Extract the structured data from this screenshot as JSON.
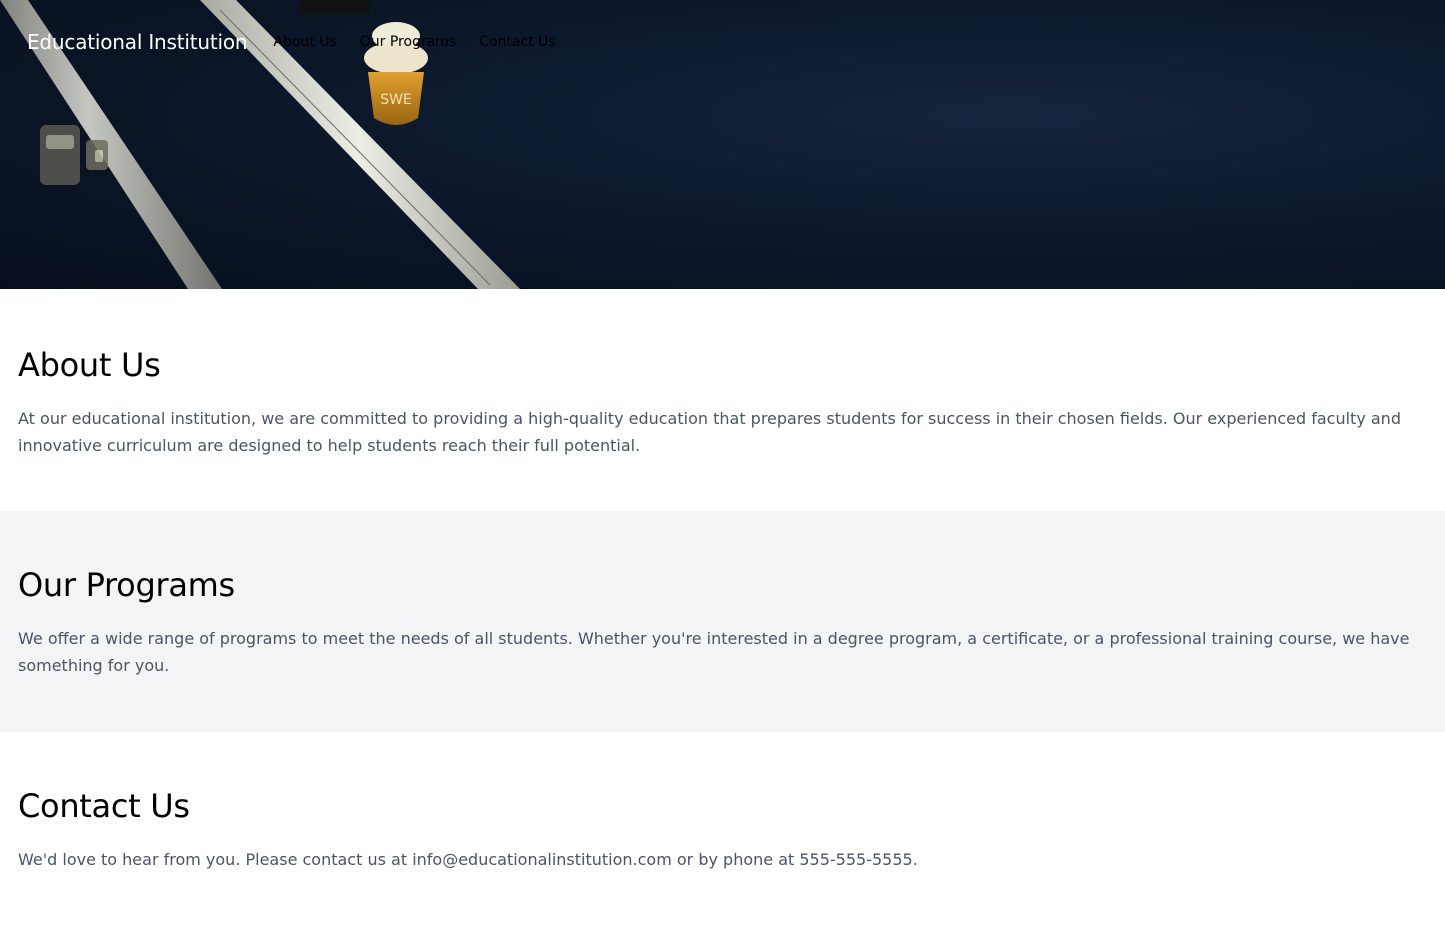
{
  "header": {
    "brand": "Educational Institution",
    "nav": [
      {
        "label": "About Us"
      },
      {
        "label": "Our Programs"
      },
      {
        "label": "Contact Us"
      }
    ]
  },
  "hero": {
    "cone_text": "SWE"
  },
  "about": {
    "title": "About Us",
    "body": "At our educational institution, we are committed to providing a high-quality education that prepares students for success in their chosen fields. Our experienced faculty and innovative curriculum are designed to help students reach their full potential."
  },
  "programs": {
    "title": "Our Programs",
    "body": "We offer a wide range of programs to meet the needs of all students. Whether you're interested in a degree program, a certificate, or a professional training course, we have something for you."
  },
  "contact": {
    "title": "Contact Us",
    "body": "We'd love to hear from you. Please contact us at info@educationalinstitution.com or by phone at 555-555-5555."
  },
  "colors": {
    "hero_bg": "#0b1628",
    "section_alt_bg": "#f3f4f6",
    "body_text": "#4b5563",
    "heading_text": "#000000"
  }
}
